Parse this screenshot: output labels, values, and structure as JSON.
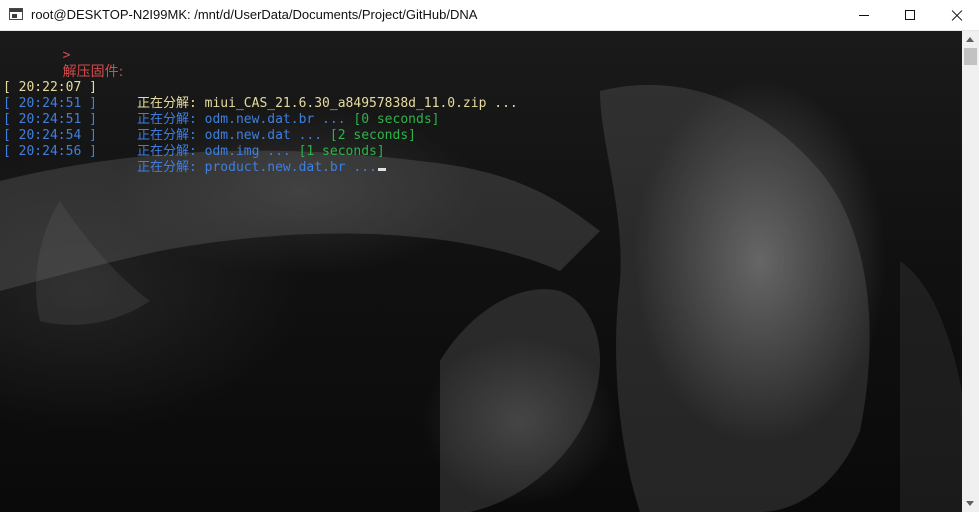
{
  "window": {
    "title": "root@DESKTOP-N2I99MK: /mnt/d/UserData/Documents/Project/GitHub/DNA"
  },
  "console": {
    "prompt": {
      "marker": ">",
      "text": "解压固件:"
    },
    "log": [
      {
        "time": "[ 20:22:07 ]",
        "action": "正在分解:",
        "file": "miui_CAS_21.6.30_a84957838d_11.0.zip ...",
        "duration": "",
        "color": "yellow"
      },
      {
        "time": "[ 20:24:51 ]",
        "action": "正在分解:",
        "file": "odm.new.dat.br ...",
        "duration": "[0 seconds]",
        "color": "blue"
      },
      {
        "time": "[ 20:24:51 ]",
        "action": "正在分解:",
        "file": "odm.new.dat ...",
        "duration": "[2 seconds]",
        "color": "blue"
      },
      {
        "time": "[ 20:24:54 ]",
        "action": "正在分解:",
        "file": "odm.img ...",
        "duration": "[1 seconds]",
        "color": "blue"
      },
      {
        "time": "[ 20:24:56 ]",
        "action": "正在分解:",
        "file": "product.new.dat.br ...",
        "duration": "",
        "color": "blue"
      }
    ]
  },
  "colors": {
    "yellow": "#e6dca0",
    "blue": "#3f7fe0",
    "green": "#2db34a",
    "prompt": "#d24b4b"
  },
  "icons": {
    "app": "terminal-icon",
    "minimize": "minimize-icon",
    "maximize": "maximize-icon",
    "close": "close-icon"
  }
}
